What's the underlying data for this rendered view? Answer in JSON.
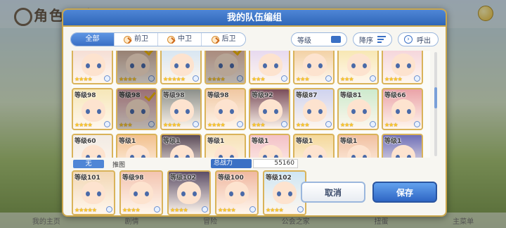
{
  "background": {
    "page_title": "角色一览"
  },
  "modal": {
    "title": "我的队伍编组"
  },
  "filters": {
    "tabs": [
      {
        "label": "全部",
        "active": true
      },
      {
        "label": "前卫",
        "active": false
      },
      {
        "label": "中卫",
        "active": false
      },
      {
        "label": "后卫",
        "active": false
      }
    ],
    "level_label": "等级",
    "order_label": "降序",
    "callout_label": "呼出"
  },
  "roster": {
    "rows": [
      [
        {
          "level": "",
          "stars": "★★★★",
          "bg": "#f3d9d0"
        },
        {
          "level": "",
          "stars": "★★★★",
          "bg": "#c9a48f",
          "selected": true
        },
        {
          "level": "",
          "stars": "★★★★★",
          "bg": "#cfe2f3"
        },
        {
          "level": "",
          "stars": "★★★★",
          "bg": "#e9b6a0",
          "selected": true
        },
        {
          "level": "",
          "stars": "★★★",
          "bg": "#e2d3f0"
        },
        {
          "level": "",
          "stars": "★★★",
          "bg": "#f0c995"
        },
        {
          "level": "",
          "stars": "★★★",
          "bg": "#f6e4a6"
        },
        {
          "level": "",
          "stars": "★★★★",
          "bg": "#f3cfd8"
        }
      ],
      [
        {
          "level": "等级98",
          "stars": "★★★★",
          "bg": "#f6e7b8"
        },
        {
          "level": "等级98",
          "stars": "★★★",
          "bg": "#d79aa2",
          "selected": true
        },
        {
          "level": "等级98",
          "stars": "★★★★",
          "bg": "#8c8f8a"
        },
        {
          "level": "等级98",
          "stars": "★★★★",
          "bg": "#f0c7a1"
        },
        {
          "level": "等级92",
          "stars": "★★★",
          "bg": "#7a4d5a"
        },
        {
          "level": "等级87",
          "stars": "★★★",
          "bg": "#cfd3ef"
        },
        {
          "level": "等级81",
          "stars": "★★★",
          "bg": "#cdeacd"
        },
        {
          "level": "等级66",
          "stars": "★★★",
          "bg": "#eaa3a8"
        }
      ],
      [
        {
          "level": "等级60",
          "stars": "★★★",
          "bg": "#f2ebe4"
        },
        {
          "level": "等级1",
          "stars": "★",
          "bg": "#f2c08d"
        },
        {
          "level": "等级1",
          "stars": "★★",
          "bg": "#5a4a58"
        },
        {
          "level": "等级1",
          "stars": "★★",
          "bg": "#f7e2b8"
        },
        {
          "level": "等级1",
          "stars": "★★",
          "bg": "#f3c0c6"
        },
        {
          "level": "等级1",
          "stars": "★★",
          "bg": "#f4d89a"
        },
        {
          "level": "等级1",
          "stars": "★★",
          "bg": "#f1bfa0"
        },
        {
          "level": "等级1",
          "stars": "★★",
          "bg": "#6f6fb8"
        }
      ]
    ]
  },
  "team": {
    "tag": "无",
    "name": "推图",
    "power_label": "总战力",
    "power_value": "55160",
    "members": [
      {
        "level": "等级101",
        "stars": "★★★★★",
        "bg": "#f2d7b4"
      },
      {
        "level": "等级98",
        "stars": "★★★★",
        "bg": "#f3c4b0"
      },
      {
        "level": "等级102",
        "stars": "★★★★",
        "bg": "#5c4d66"
      },
      {
        "level": "等级100",
        "stars": "★★★★",
        "bg": "#f0b8a0"
      },
      {
        "level": "等级102",
        "stars": "★★★★",
        "bg": "#cfe6f4"
      }
    ]
  },
  "buttons": {
    "cancel": "取消",
    "save": "保存"
  },
  "bottom_nav": [
    "我的主页",
    "剧情",
    "冒险",
    "公会之家",
    "扭蛋",
    "主菜单"
  ]
}
